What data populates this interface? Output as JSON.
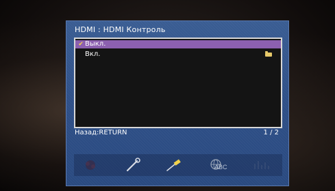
{
  "panel": {
    "title": "HDMI : HDMI Контроль"
  },
  "options": [
    {
      "label": "Выкл.",
      "selected": true,
      "checked": true
    },
    {
      "label": "Вкл.",
      "selected": false,
      "checked": false,
      "icon": "folder-icon"
    }
  ],
  "footer": {
    "back_hint": "Назад:RETURN",
    "page": "1 / 2"
  },
  "icon_bar": {
    "items": [
      {
        "name": "speaker-setup-icon",
        "active": false
      },
      {
        "name": "wrench-icon",
        "active": true
      },
      {
        "name": "hdmi-cable-icon",
        "active": true
      },
      {
        "name": "language-globe-icon",
        "label": "ABC",
        "active": true
      },
      {
        "name": "equalizer-icon",
        "active": false
      }
    ]
  },
  "colors": {
    "panel": "#2f5088",
    "highlight": "#8c60b0",
    "list_bg": "#141414",
    "check": "#f3d34a"
  }
}
